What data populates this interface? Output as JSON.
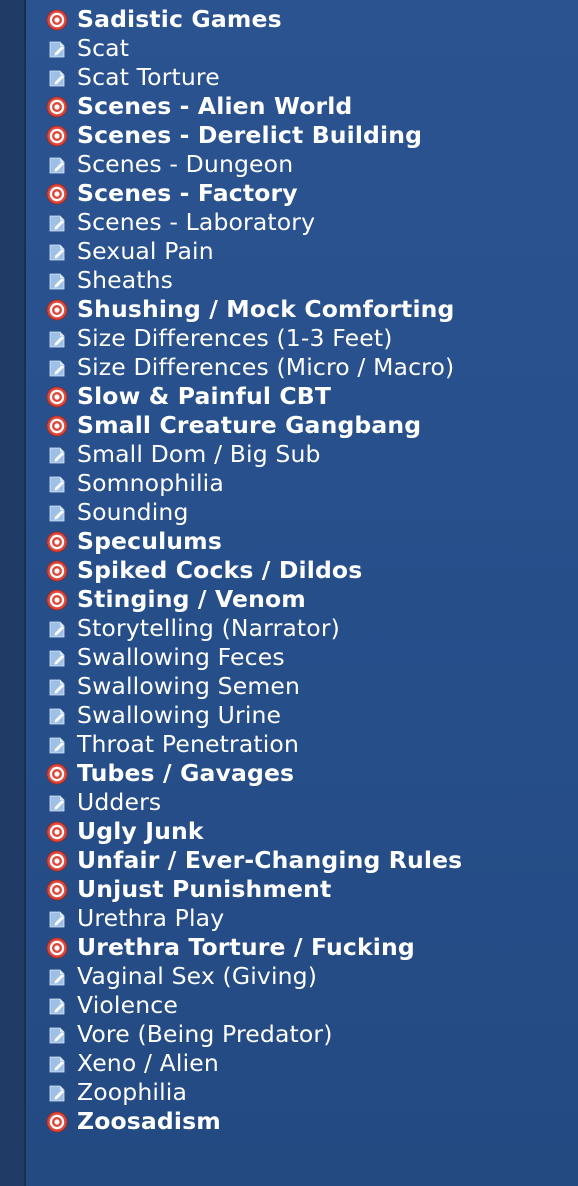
{
  "colors": {
    "panel": "#27508c",
    "rail": "#203c66",
    "text": "#ffffff",
    "target_icon": "#e0463a",
    "note_icon": "#9fc0e6"
  },
  "icons": {
    "strong": "target-icon",
    "normal": "note-icon"
  },
  "items": [
    {
      "label": "Sadistic Games",
      "strong": true
    },
    {
      "label": "Scat",
      "strong": false
    },
    {
      "label": "Scat Torture",
      "strong": false
    },
    {
      "label": "Scenes - Alien World",
      "strong": true
    },
    {
      "label": "Scenes - Derelict Building",
      "strong": true
    },
    {
      "label": "Scenes - Dungeon",
      "strong": false
    },
    {
      "label": "Scenes - Factory",
      "strong": true
    },
    {
      "label": "Scenes - Laboratory",
      "strong": false
    },
    {
      "label": "Sexual Pain",
      "strong": false
    },
    {
      "label": "Sheaths",
      "strong": false
    },
    {
      "label": "Shushing / Mock Comforting",
      "strong": true
    },
    {
      "label": "Size Differences (1-3 Feet)",
      "strong": false
    },
    {
      "label": "Size Differences (Micro / Macro)",
      "strong": false
    },
    {
      "label": "Slow & Painful CBT",
      "strong": true
    },
    {
      "label": "Small Creature Gangbang",
      "strong": true
    },
    {
      "label": "Small Dom / Big Sub",
      "strong": false
    },
    {
      "label": "Somnophilia",
      "strong": false
    },
    {
      "label": "Sounding",
      "strong": false
    },
    {
      "label": "Speculums",
      "strong": true
    },
    {
      "label": "Spiked Cocks / Dildos",
      "strong": true
    },
    {
      "label": "Stinging / Venom",
      "strong": true
    },
    {
      "label": "Storytelling (Narrator)",
      "strong": false
    },
    {
      "label": "Swallowing Feces",
      "strong": false
    },
    {
      "label": "Swallowing Semen",
      "strong": false
    },
    {
      "label": "Swallowing Urine",
      "strong": false
    },
    {
      "label": "Throat Penetration",
      "strong": false
    },
    {
      "label": "Tubes / Gavages",
      "strong": true
    },
    {
      "label": "Udders",
      "strong": false
    },
    {
      "label": "Ugly Junk",
      "strong": true
    },
    {
      "label": "Unfair / Ever-Changing Rules",
      "strong": true
    },
    {
      "label": "Unjust Punishment",
      "strong": true
    },
    {
      "label": "Urethra Play",
      "strong": false
    },
    {
      "label": "Urethra Torture / Fucking",
      "strong": true
    },
    {
      "label": "Vaginal Sex (Giving)",
      "strong": false
    },
    {
      "label": "Violence",
      "strong": false
    },
    {
      "label": "Vore (Being Predator)",
      "strong": false
    },
    {
      "label": "Xeno / Alien",
      "strong": false
    },
    {
      "label": "Zoophilia",
      "strong": false
    },
    {
      "label": "Zoosadism",
      "strong": true
    }
  ]
}
